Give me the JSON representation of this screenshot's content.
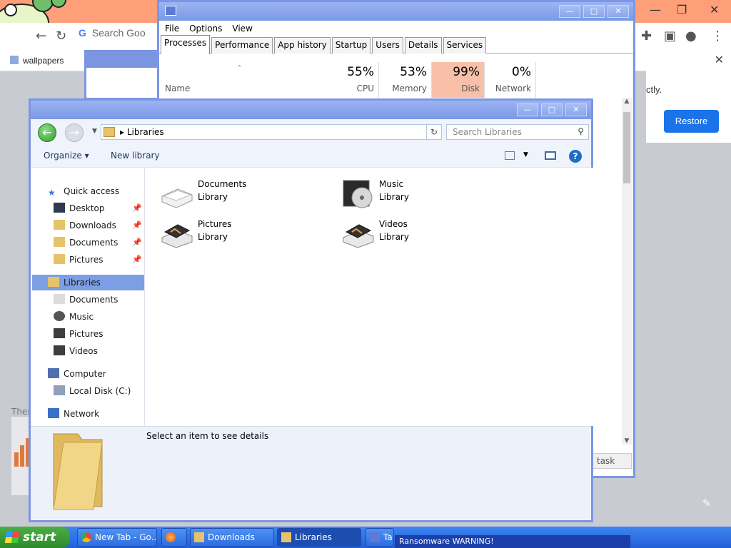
{
  "browser": {
    "search_placeholder": "Search Goo",
    "bookmark": "wallpapers",
    "restore_msg": "ctly.",
    "restore_button": "Restore",
    "bg_text": "Ther"
  },
  "taskmgr": {
    "menu": [
      "File",
      "Options",
      "View"
    ],
    "tabs": [
      "Processes",
      "Performance",
      "App history",
      "Startup",
      "Users",
      "Details",
      "Services"
    ],
    "name_col": "Name",
    "cols": [
      {
        "pct": "55%",
        "label": "CPU"
      },
      {
        "pct": "53%",
        "label": "Memory"
      },
      {
        "pct": "99%",
        "label": "Disk"
      },
      {
        "pct": "0%",
        "label": "Network"
      }
    ],
    "end_task": "task"
  },
  "explorer": {
    "breadcrumb": "Libraries",
    "search_placeholder": "Search Libraries",
    "organize": "Organize",
    "new_library": "New library",
    "nav": {
      "quick_access": "Quick access",
      "quick_items": [
        "Desktop",
        "Downloads",
        "Documents",
        "Pictures"
      ],
      "libraries": "Libraries",
      "lib_items": [
        "Documents",
        "Music",
        "Pictures",
        "Videos"
      ],
      "computer": "Computer",
      "local_disk": "Local Disk (C:)",
      "network": "Network"
    },
    "libraries": [
      {
        "name": "Documents",
        "sub": "Library"
      },
      {
        "name": "Music",
        "sub": "Library"
      },
      {
        "name": "Pictures",
        "sub": "Library"
      },
      {
        "name": "Videos",
        "sub": "Library"
      }
    ],
    "details_msg": "Select an item to see details"
  },
  "taskbar": {
    "start": "start",
    "tasks": [
      "New Tab - Go...",
      "",
      "Downloads",
      "Libraries",
      "Ta"
    ],
    "ransom": "Ransomware WARNING!"
  },
  "colors": {
    "accent": "#7b96e4",
    "disk_hot": "#f8c0a8",
    "restore_btn": "#1a73e8",
    "taskbar": "#235fd8"
  }
}
